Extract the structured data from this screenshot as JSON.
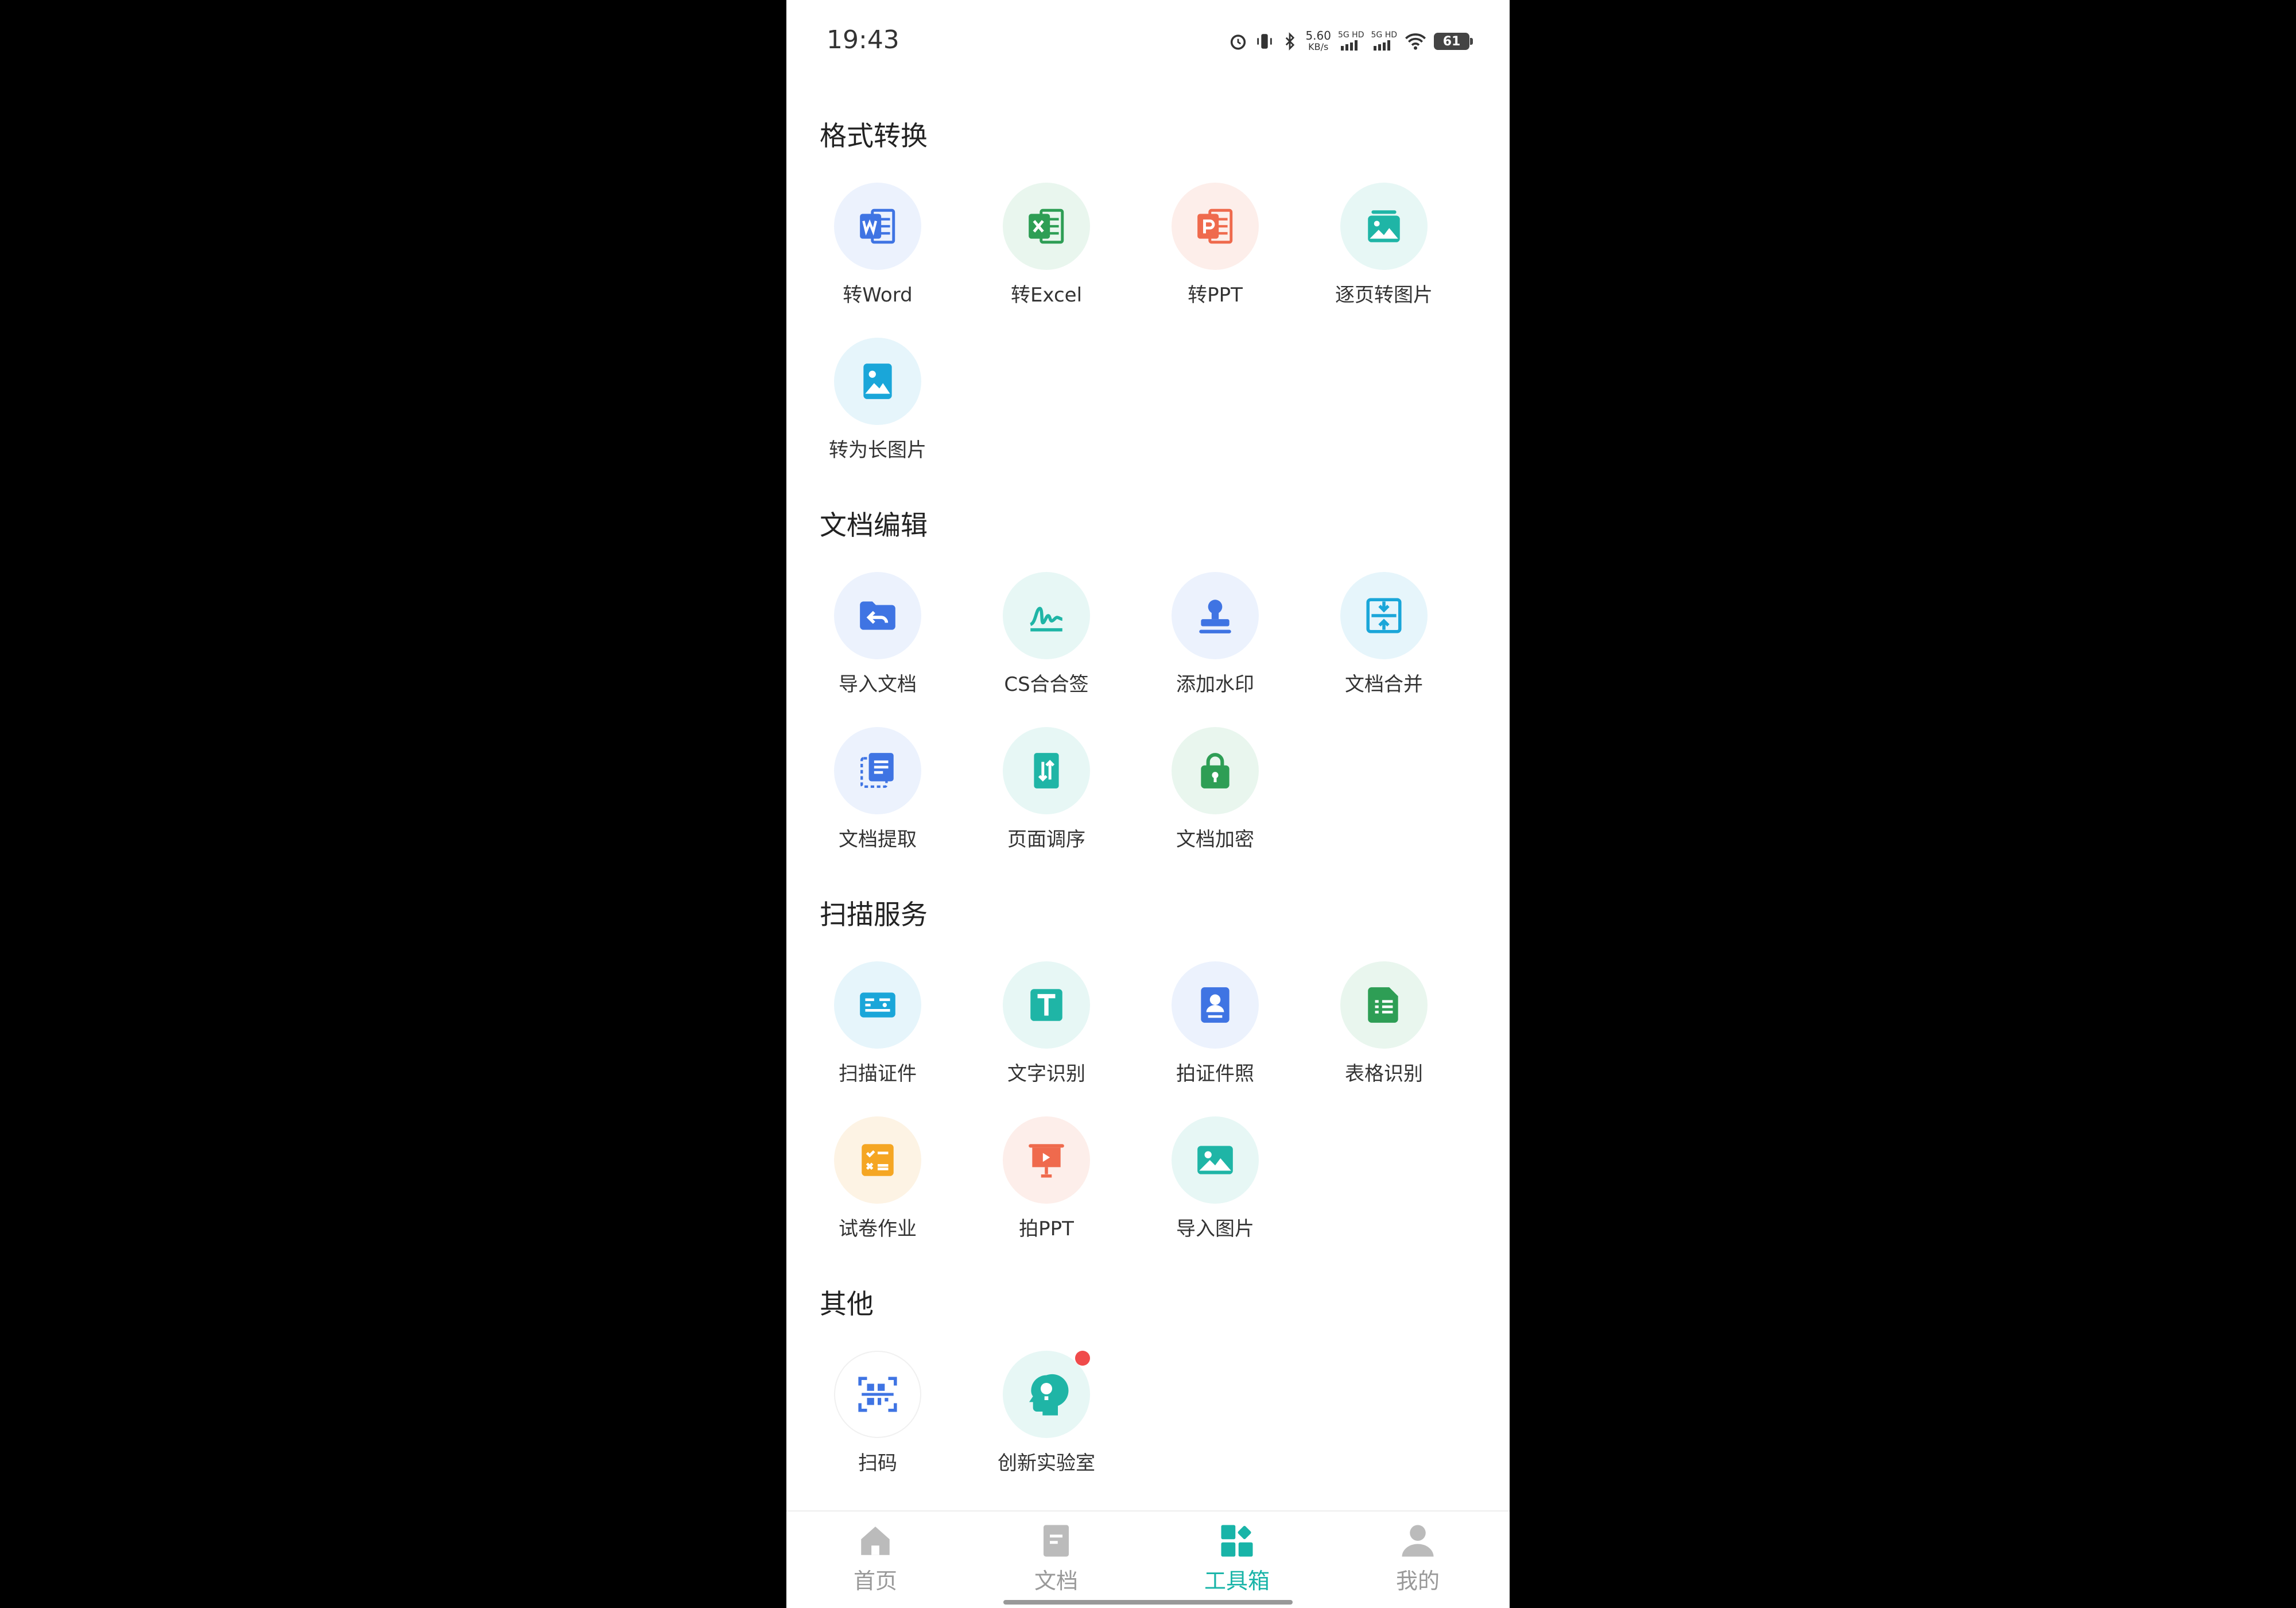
{
  "status_bar": {
    "time": "19:43",
    "speed_value": "5.60",
    "speed_unit": "KB/s",
    "sim1": "5G HD",
    "sim2": "5G HD",
    "battery": "61"
  },
  "sections": [
    {
      "title": "格式转换",
      "items": [
        {
          "label": "转Word",
          "icon": "word-icon"
        },
        {
          "label": "转Excel",
          "icon": "excel-icon"
        },
        {
          "label": "转PPT",
          "icon": "ppt-icon"
        },
        {
          "label": "逐页转图片",
          "icon": "page-image-icon"
        },
        {
          "label": "转为长图片",
          "icon": "long-image-icon"
        }
      ]
    },
    {
      "title": "文档编辑",
      "items": [
        {
          "label": "导入文档",
          "icon": "import-folder-icon"
        },
        {
          "label": "CS合合签",
          "icon": "signature-icon"
        },
        {
          "label": "添加水印",
          "icon": "stamp-icon"
        },
        {
          "label": "文档合并",
          "icon": "merge-icon"
        },
        {
          "label": "文档提取",
          "icon": "extract-icon"
        },
        {
          "label": "页面调序",
          "icon": "reorder-icon"
        },
        {
          "label": "文档加密",
          "icon": "lock-icon"
        }
      ]
    },
    {
      "title": "扫描服务",
      "items": [
        {
          "label": "扫描证件",
          "icon": "id-card-icon"
        },
        {
          "label": "文字识别",
          "icon": "text-recognition-icon"
        },
        {
          "label": "拍证件照",
          "icon": "id-photo-icon"
        },
        {
          "label": "表格识别",
          "icon": "table-recognition-icon"
        },
        {
          "label": "试卷作业",
          "icon": "exam-icon"
        },
        {
          "label": "拍PPT",
          "icon": "presentation-icon"
        },
        {
          "label": "导入图片",
          "icon": "import-image-icon"
        }
      ]
    },
    {
      "title": "其他",
      "items": [
        {
          "label": "扫码",
          "icon": "qr-scan-icon"
        },
        {
          "label": "创新实验室",
          "icon": "lab-icon"
        }
      ]
    }
  ],
  "bottom_nav": [
    {
      "label": "首页",
      "icon": "home-icon"
    },
    {
      "label": "文档",
      "icon": "document-icon"
    },
    {
      "label": "工具箱",
      "icon": "toolbox-icon"
    },
    {
      "label": "我的",
      "icon": "profile-icon"
    }
  ],
  "colors": {
    "accent": "#19b4a8",
    "word": "#3f74e3",
    "excel": "#2e9e55",
    "ppt": "#ef6a4d",
    "teal": "#1fb5a6",
    "orange": "#f5a623",
    "badge": "#f04b4b"
  }
}
